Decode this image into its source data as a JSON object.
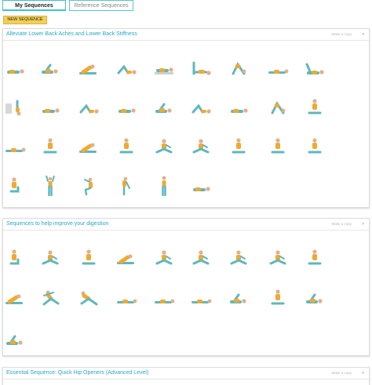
{
  "tabs": [
    {
      "label": "My Sequences",
      "active": true
    },
    {
      "label": "Reference Sequences",
      "active": false
    }
  ],
  "new_sequence_label": "NEW SEQUENCE",
  "colors": {
    "accent": "#3fc3c8",
    "title": "#2aa8c4",
    "button": "#f2cf57",
    "figure_body": "#f1a92f",
    "figure_limbs": "#5fb7be"
  },
  "cards": [
    {
      "title": "Alleviate Lower Back Aches and Lower Back Stiffness",
      "action": "Make a copy",
      "collapse_icon": "chevron-icon",
      "poses": [
        "lying",
        "lying-twist",
        "seated-forward",
        "lying-knees-up",
        "lying-blanket",
        "bridge",
        "forward-bend",
        "lying-stretch",
        "lying-leg-up",
        "shoulder-stand",
        "lying",
        "lying-knees-up",
        "lying",
        "lying-twist",
        "lying-knees-up",
        "lying",
        "forward-bend",
        "seated",
        "lying-stretch",
        "seated",
        "seated-forward",
        "seated",
        "seated-twist",
        "seated-twist",
        "seated",
        "seated",
        "seated",
        "kneeling",
        "standing-arms-up",
        "chair-pose",
        "standing-bend",
        "standing",
        "lying"
      ]
    },
    {
      "title": "Sequences to help improve your digestion",
      "action": "Make a copy",
      "collapse_icon": "chevron-icon",
      "poses": [
        "kneeling",
        "seated-twist",
        "seated",
        "seated-forward",
        "seated-twist",
        "seated-twist",
        "seated-twist",
        "seated-twist",
        "seated",
        "seated-forward",
        "twist-lunge",
        "lunge",
        "lying-stretch",
        "lying-stretch",
        "lying-stretch",
        "lying-twist",
        "seated",
        "lying-twist",
        "lying-twist"
      ]
    },
    {
      "title": "Essential Sequence: Quick Hip Openers (Advanced Level)",
      "action": "Make a copy",
      "collapse_icon": "chevron-icon",
      "poses": []
    }
  ]
}
